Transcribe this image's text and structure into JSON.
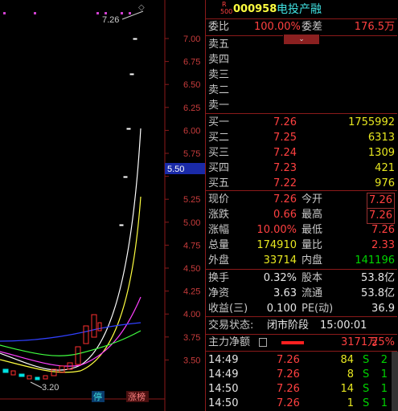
{
  "header": {
    "code": "000958",
    "name": "电投产融",
    "badge_r": "R",
    "badge_num": "500"
  },
  "commission": {
    "ratio_label": "委比",
    "ratio": "100.00%",
    "diff_label": "委差",
    "diff": "176.5万"
  },
  "sell": [
    {
      "label": "卖五",
      "price": "",
      "vol": ""
    },
    {
      "label": "卖四",
      "price": "",
      "vol": ""
    },
    {
      "label": "卖三",
      "price": "",
      "vol": ""
    },
    {
      "label": "卖二",
      "price": "",
      "vol": ""
    },
    {
      "label": "卖一",
      "price": "",
      "vol": ""
    }
  ],
  "buy": [
    {
      "label": "买一",
      "price": "7.26",
      "vol": "1755992"
    },
    {
      "label": "买二",
      "price": "7.25",
      "vol": "6313"
    },
    {
      "label": "买三",
      "price": "7.24",
      "vol": "1309"
    },
    {
      "label": "买四",
      "price": "7.23",
      "vol": "421"
    },
    {
      "label": "买五",
      "price": "7.22",
      "vol": "976"
    }
  ],
  "quote": [
    {
      "l1": "现价",
      "v1": "7.26",
      "l2": "今开",
      "v2": "7.26"
    },
    {
      "l1": "涨跌",
      "v1": "0.66",
      "l2": "最高",
      "v2": "7.26"
    },
    {
      "l1": "涨幅",
      "v1": "10.00%",
      "l2": "最低",
      "v2": "7.26"
    },
    {
      "l1": "总量",
      "v1": "174910",
      "l2": "量比",
      "v2": "2.33"
    },
    {
      "l1": "外盘",
      "v1": "33714",
      "l2": "内盘",
      "v2": "141196"
    }
  ],
  "stats": [
    {
      "l1": "换手",
      "v1": "0.32%",
      "l2": "股本",
      "v2": "53.8亿"
    },
    {
      "l1": "净资",
      "v1": "3.63",
      "l2": "流通",
      "v2": "53.8亿"
    },
    {
      "l1": "收益(三)",
      "v1": "0.100",
      "l2": "PE(动)",
      "v2": "36.9"
    }
  ],
  "status": {
    "label": "交易状态:",
    "value": "闭市阶段",
    "time": "15:00:01"
  },
  "main_force": {
    "label": "主力净额",
    "value": "3171万",
    "pct": "25%"
  },
  "ticks": [
    {
      "time": "14:49",
      "price": "7.26",
      "vol": "84",
      "side": "S",
      "num": "2"
    },
    {
      "time": "14:49",
      "price": "7.26",
      "vol": "8",
      "side": "S",
      "num": "1"
    },
    {
      "time": "14:50",
      "price": "7.26",
      "vol": "14",
      "side": "S",
      "num": "1"
    },
    {
      "time": "14:50",
      "price": "7.26",
      "vol": "1",
      "side": "S",
      "num": "1"
    }
  ],
  "chart_data": {
    "type": "candlestick",
    "y_axis_ticks": [
      "7.00",
      "6.75",
      "6.50",
      "6.25",
      "6.00",
      "5.75",
      "5.50",
      "5.25",
      "5.00",
      "4.75",
      "4.50",
      "4.25",
      "4.00",
      "3.75",
      "3.50"
    ],
    "current_marker": "5.50",
    "high_label": "7.26",
    "low_label": "3.20",
    "tags": [
      "停",
      "涨榜"
    ],
    "colors": {
      "up": "#ff3030",
      "down": "#00e0e0",
      "ma5": "#ffffff",
      "ma10": "#ffff40",
      "ma20": "#ff40ff",
      "ma30": "#40ff40",
      "ma60": "#4040ff"
    }
  }
}
